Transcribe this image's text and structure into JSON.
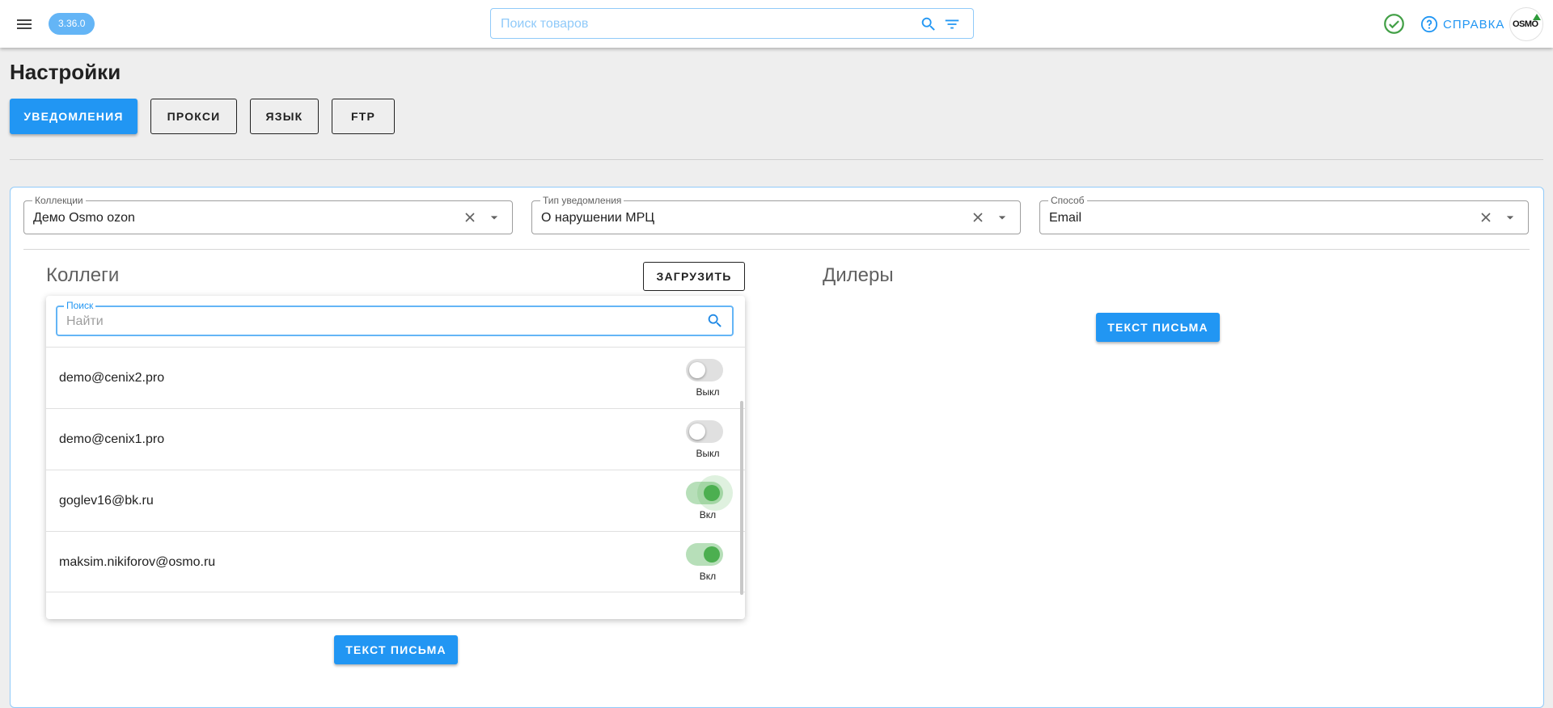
{
  "topbar": {
    "version": "3.36.0",
    "search_placeholder": "Поиск товаров",
    "help_label": "СПРАВКА",
    "logo_text": "OSMO",
    "icons": {
      "menu": "menu-icon",
      "search": "search-icon",
      "filter": "filter-icon",
      "status": "check-circle-icon",
      "help": "help-circle-icon"
    }
  },
  "page": {
    "title": "Настройки",
    "tabs": [
      {
        "label": "УВЕДОМЛЕНИЯ",
        "active": true
      },
      {
        "label": "ПРОКСИ",
        "active": false
      },
      {
        "label": "ЯЗЫК",
        "active": false
      },
      {
        "label": "FTP",
        "active": false
      }
    ]
  },
  "filters": {
    "collections": {
      "legend": "Коллекции",
      "value": "Демо Osmo ozon"
    },
    "notification_type": {
      "legend": "Тип уведомления",
      "value": "О нарушении МРЦ"
    },
    "method": {
      "legend": "Способ",
      "value": "Email"
    }
  },
  "colleagues": {
    "title": "Коллеги",
    "upload_label": "ЗАГРУЗИТЬ",
    "search_legend": "Поиск",
    "search_placeholder": "Найти",
    "rows": [
      {
        "email": "demo@cenix2.pro",
        "enabled": false,
        "state": "Выкл"
      },
      {
        "email": "demo@cenix1.pro",
        "enabled": false,
        "state": "Выкл"
      },
      {
        "email": "goglev16@bk.ru",
        "enabled": true,
        "state": "Вкл"
      },
      {
        "email": "maksim.nikiforov@osmo.ru",
        "enabled": true,
        "state": "Вкл"
      }
    ],
    "letter_label": "ТЕКСТ ПИСЬМА"
  },
  "dealers": {
    "title": "Дилеры",
    "letter_label": "ТЕКСТ ПИСЬМА"
  },
  "colors": {
    "accent": "#2196f3",
    "toggle_on": "#4caf50",
    "background": "#eeeeee"
  }
}
